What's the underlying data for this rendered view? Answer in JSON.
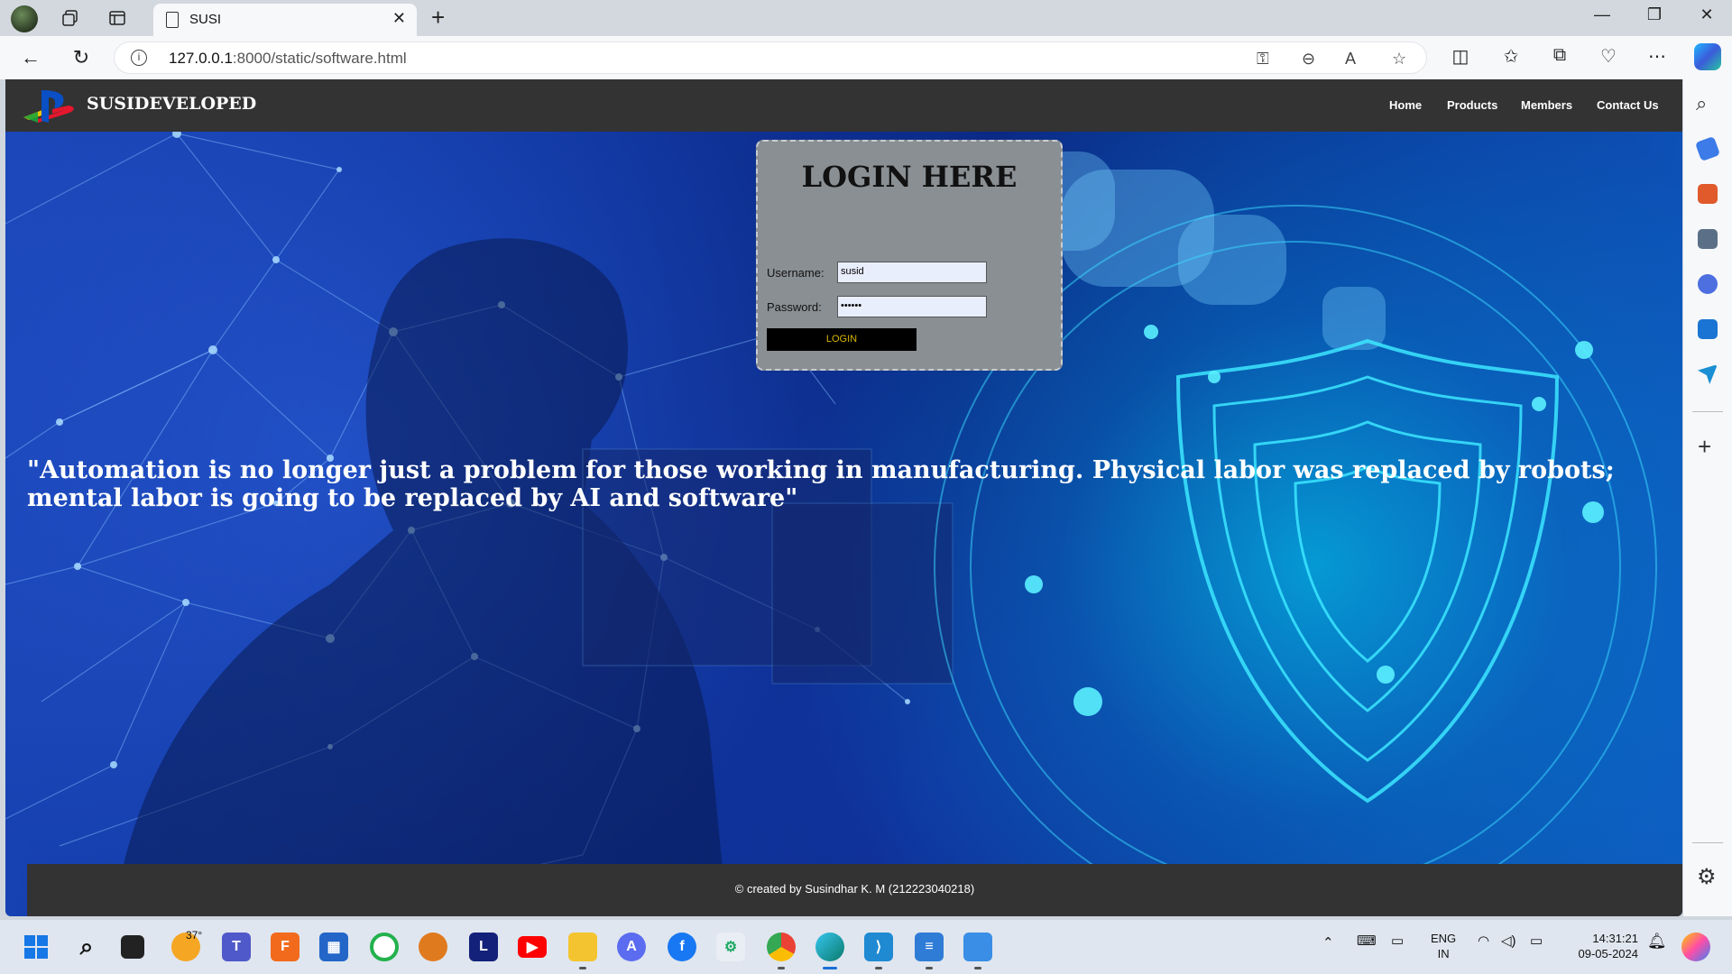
{
  "browser": {
    "tab_title": "SUSI",
    "url_host": "127.0.0.1",
    "url_rest": ":8000/static/software.html"
  },
  "site": {
    "brand": "SUSIDEVELOPED",
    "nav": [
      "Home",
      "Products",
      "Members",
      "Contact Us"
    ],
    "login": {
      "title": "LOGIN HERE",
      "username_label": "Username:",
      "username_value": "susid",
      "password_label": "Password:",
      "password_value": "••••••",
      "button_label": "LOGIN"
    },
    "quote": "\"Automation is no longer just a problem for those working in manufacturing. Physical labor was replaced by robots; mental labor is going to be replaced by AI and software\"",
    "footer": "© created by Susindhar K. M (212223040218)"
  },
  "taskbar": {
    "weather": "37°",
    "lang_line1": "ENG",
    "lang_line2": "IN",
    "time": "14:31:21",
    "date": "09-05-2024"
  },
  "colors": {
    "header_bg": "#333333",
    "login_box_bg": "#8a8f93",
    "login_button_text": "#d8b500"
  }
}
